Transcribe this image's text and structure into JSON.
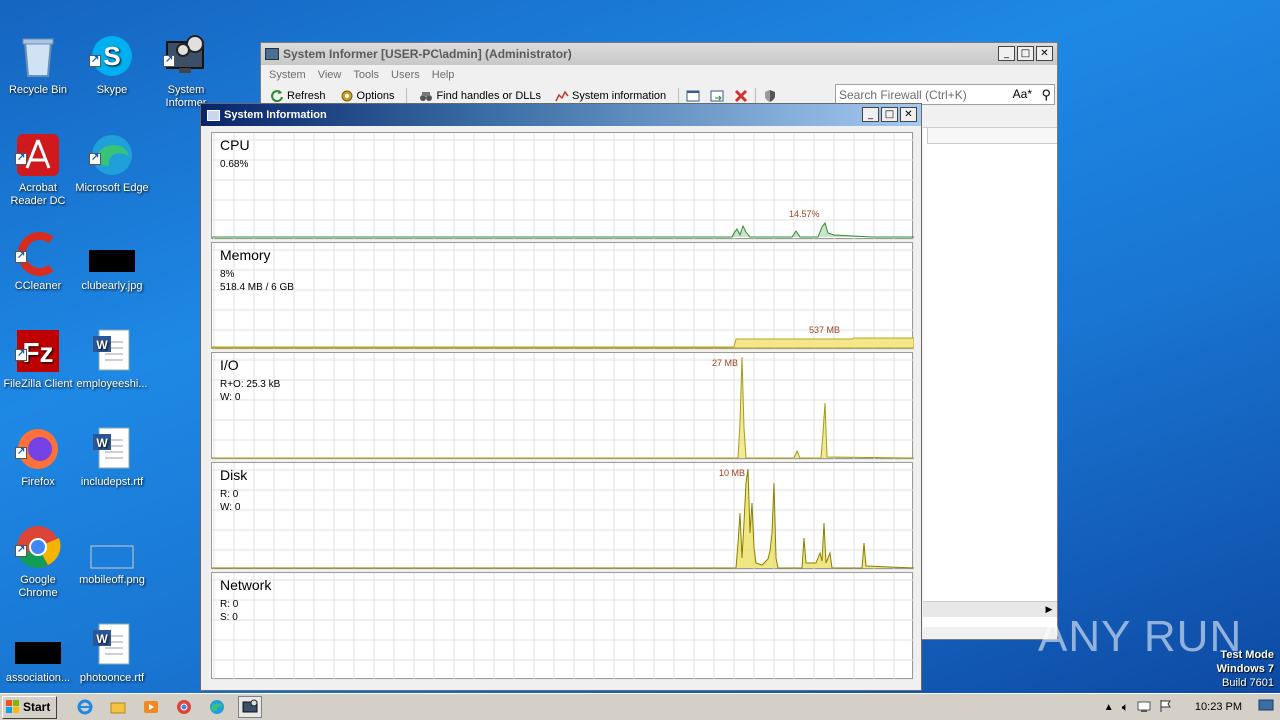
{
  "desktop": {
    "icons": [
      {
        "label": "Recycle Bin"
      },
      {
        "label": "Skype"
      },
      {
        "label": "System\nInformer"
      },
      {
        "label": "Acrobat\nReader DC"
      },
      {
        "label": "Microsoft Edge"
      },
      {
        "label": "CCleaner"
      },
      {
        "label": "clubearly.jpg"
      },
      {
        "label": "FileZilla Client"
      },
      {
        "label": "employeeshi..."
      },
      {
        "label": "Firefox"
      },
      {
        "label": "includepst.rtf"
      },
      {
        "label": "Google\nChrome"
      },
      {
        "label": "mobileoff.png"
      },
      {
        "label": "association..."
      },
      {
        "label": "photoonce.rtf"
      }
    ]
  },
  "main_window": {
    "title": "System Informer [USER-PC\\admin] (Administrator)",
    "menu": [
      "System",
      "View",
      "Tools",
      "Users",
      "Help"
    ],
    "toolbar": {
      "refresh": "Refresh",
      "options": "Options",
      "find_handles": "Find handles or DLLs",
      "system_information": "System information"
    },
    "search_placeholder": "Search Firewall (Ctrl+K)",
    "search_case": "Aa"
  },
  "sysinfo_window": {
    "title": "System Information",
    "panels": {
      "cpu": {
        "label": "CPU",
        "line1": "0.68%",
        "annotation": "14.57%"
      },
      "memory": {
        "label": "Memory",
        "line1": "8%",
        "line2": "518.4 MB / 6 GB",
        "annotation": "537 MB"
      },
      "io": {
        "label": "I/O",
        "line1": "R+O: 25.3 kB",
        "line2": "W: 0",
        "annotation": "27 MB"
      },
      "disk": {
        "label": "Disk",
        "line1": "R: 0",
        "line2": "W: 0",
        "annotation": "10 MB"
      },
      "network": {
        "label": "Network",
        "line1": "R: 0",
        "line2": "S: 0"
      }
    },
    "colors": {
      "cpu": "#2e8b2e",
      "memory": "#e8d24a",
      "io": "#d8cc30",
      "disk": "#d8cc30"
    }
  },
  "watermark": "ANY RUN",
  "testmode": {
    "line1": "Test Mode",
    "line2": "Windows 7",
    "line3": "Build 7601"
  },
  "taskbar": {
    "start": "Start",
    "clock": "10:23 PM"
  }
}
